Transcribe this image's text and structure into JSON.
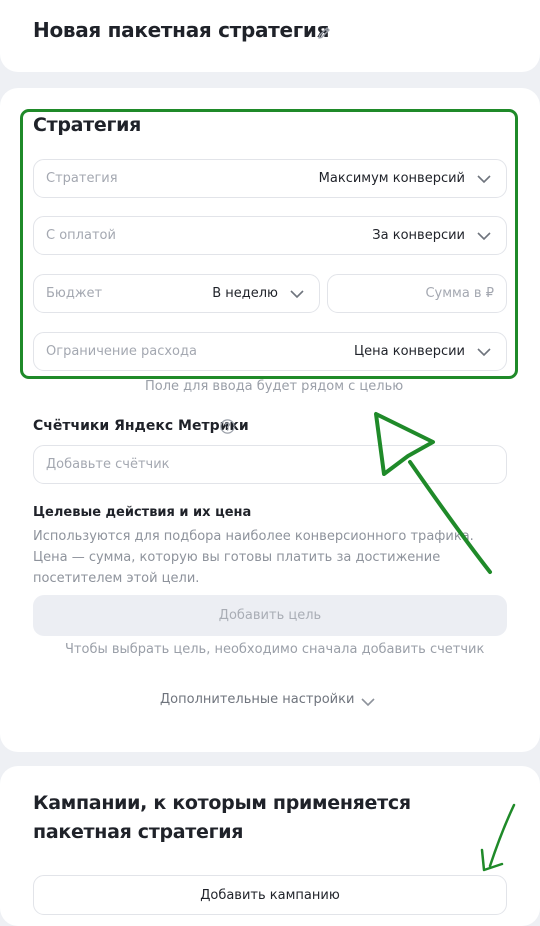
{
  "header": {
    "title": "Новая пакетная стратегия",
    "edit_icon": "pencil-icon"
  },
  "strategy": {
    "section_title": "Стратегия",
    "fields": {
      "strategy": {
        "label": "Стратегия",
        "value": "Максимум конверсий"
      },
      "payment": {
        "label": "С оплатой",
        "value": "За конверсии"
      },
      "budget": {
        "label": "Бюджет",
        "value": "В неделю"
      },
      "amount": {
        "placeholder": "Сумма в ₽"
      },
      "spend_limit": {
        "label": "Ограничение расхода",
        "value": "Цена конверсии"
      }
    },
    "hint": "Поле для ввода будет рядом с целью"
  },
  "metrica": {
    "label": "Счётчики Яндекс Метрики",
    "help_icon": "question-circle-icon",
    "placeholder": "Добавьте счётчик"
  },
  "goals": {
    "title": "Целевые действия и их цена",
    "description": "Используются для подбора наиболее конверсионного трафика. Цена — сумма, которую вы готовы платить за достижение посетителем этой цели.",
    "add_button": "Добавить цель",
    "hint": "Чтобы выбрать цель, необходимо сначала добавить счетчик"
  },
  "advanced": {
    "label": "Дополнительные настройки"
  },
  "campaigns": {
    "title": "Кампании, к которым применяется пакетная стратегия",
    "add_button": "Добавить кампанию"
  },
  "colors": {
    "annotation_green": "#1f8a29",
    "text_primary": "#1f2229",
    "text_muted": "#9a9fa8",
    "page_bg": "#eef0f4"
  }
}
